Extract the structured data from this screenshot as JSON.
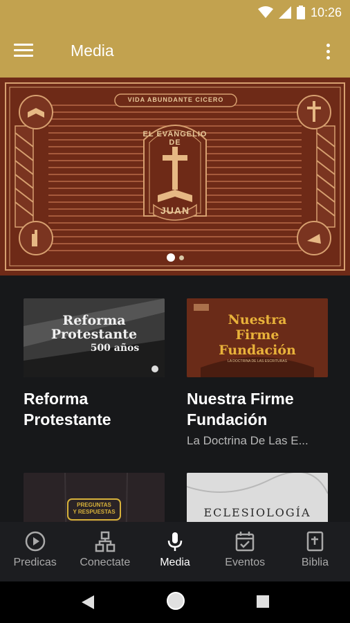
{
  "status": {
    "time": "10:26"
  },
  "appbar": {
    "title": "Media"
  },
  "banner": {
    "top_label": "VIDA ABUNDANTE CICERO",
    "arc_text": "EL EVANGELIO DE",
    "bottom_text": "JUAN",
    "page_count": 2,
    "active_page": 0
  },
  "cards": [
    {
      "title_line1": "Reforma",
      "title_line2": "Protestante",
      "subtitle": "",
      "thumb_text": [
        "Reforma",
        "Protestante",
        "500 años"
      ]
    },
    {
      "title_line1": "Nuestra Firme",
      "title_line2": "Fundación",
      "subtitle": "La Doctrina De Las E...",
      "thumb_text": [
        "Nuestra",
        "Firme",
        "Fundación",
        "LA DOCTRINA DE LAS ESCRITURAS"
      ]
    },
    {
      "title_line1": "",
      "title_line2": "",
      "subtitle": "",
      "thumb_text": [
        "PREGUNTAS",
        "Y RESPUESTAS"
      ]
    },
    {
      "title_line1": "",
      "title_line2": "",
      "subtitle": "",
      "thumb_text": [
        "ECLESIOLOGÍA"
      ]
    }
  ],
  "nav": {
    "items": [
      {
        "label": "Predicas",
        "icon": "play-circle-icon"
      },
      {
        "label": "Conectate",
        "icon": "network-icon"
      },
      {
        "label": "Media",
        "icon": "microphone-icon"
      },
      {
        "label": "Eventos",
        "icon": "calendar-check-icon"
      },
      {
        "label": "Biblia",
        "icon": "bible-icon"
      }
    ],
    "active": "Media"
  },
  "colors": {
    "accent": "#c2a24f",
    "banner_bg": "#6e2a17",
    "background": "#17181a"
  }
}
